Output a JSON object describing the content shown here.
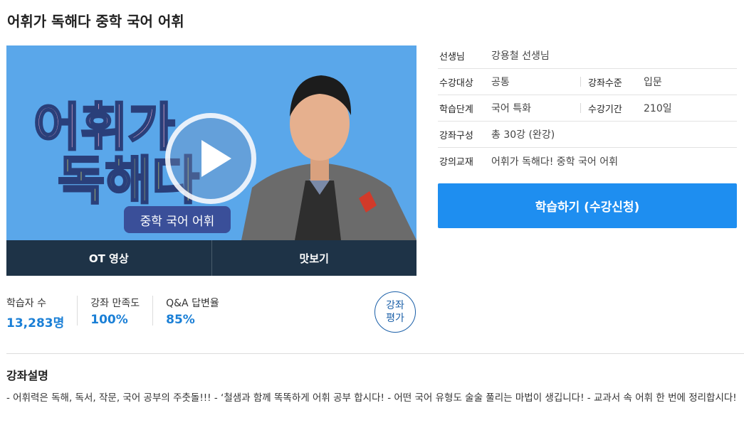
{
  "page": {
    "title": "어휘가 독해다 중학 국어 어휘"
  },
  "video": {
    "logo_line1": "어휘가",
    "logo_line2": "독해다",
    "course_pill": "중학 국어 어휘",
    "tabs": [
      {
        "label": "OT 영상"
      },
      {
        "label": "맛보기"
      }
    ],
    "play_icon": "play-icon"
  },
  "stats": [
    {
      "label": "학습자 수",
      "value": "13,283명"
    },
    {
      "label": "강좌 만족도",
      "value": "100%"
    },
    {
      "label": "Q&A 답변율",
      "value": "85%"
    }
  ],
  "rate_button": {
    "line1": "강좌",
    "line2": "평가"
  },
  "info": {
    "teacher": {
      "label": "선생님",
      "value": "강용철 선생님"
    },
    "target": {
      "label": "수강대상",
      "value": "공통"
    },
    "level": {
      "label": "강좌수준",
      "value": "입문"
    },
    "stage": {
      "label": "학습단계",
      "value": "국어 특화"
    },
    "period": {
      "label": "수강기간",
      "value": "210일"
    },
    "composition": {
      "label": "강좌구성",
      "value": "총 30강 (완강)"
    },
    "textbook": {
      "label": "강의교재",
      "value": "어휘가 독해다! 중학 국어 어휘"
    }
  },
  "apply_button": {
    "label": "학습하기 (수강신청)"
  },
  "description": {
    "title": "강좌설명",
    "text": "- 어휘력은 독해, 독서, 작문, 국어 공부의 주춧돌!!! - ‘철샘과 함께 똑똑하게 어휘 공부 합시다! - 어떤 국어 유형도 술술 풀리는 마법이 생깁니다! - 교과서 속 어휘 한 번에 정리합시다!"
  },
  "colors": {
    "accent": "#1e8ef0",
    "video_bg": "#5aa7ea",
    "tab_bar": "#1e3347",
    "stat_value": "#1a7fd6"
  }
}
